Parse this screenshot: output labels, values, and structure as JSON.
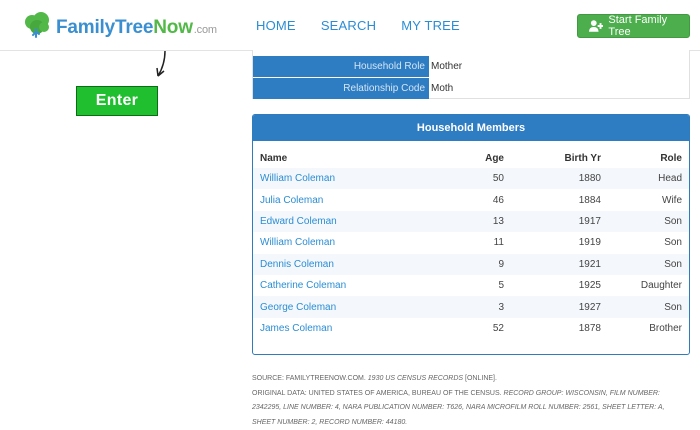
{
  "header": {
    "logo": {
      "family": "FamilyTree",
      "now": "Now",
      "com": ".com"
    },
    "nav": [
      "HOME",
      "SEARCH",
      "MY TREE"
    ],
    "start_button": "Start Family Tree"
  },
  "enter_button": "Enter",
  "top_rows": [
    {
      "label": "Household Role",
      "value": "Mother"
    },
    {
      "label": "Relationship Code",
      "value": "Moth"
    }
  ],
  "household": {
    "title": "Household Members",
    "columns": {
      "name": "Name",
      "age": "Age",
      "birth_yr": "Birth Yr",
      "role": "Role"
    },
    "members": [
      {
        "name": "William Coleman",
        "age": "50",
        "birth_yr": "1880",
        "role": "Head"
      },
      {
        "name": "Julia Coleman",
        "age": "46",
        "birth_yr": "1884",
        "role": "Wife"
      },
      {
        "name": "Edward Coleman",
        "age": "13",
        "birth_yr": "1917",
        "role": "Son"
      },
      {
        "name": "William Coleman",
        "age": "11",
        "birth_yr": "1919",
        "role": "Son"
      },
      {
        "name": "Dennis Coleman",
        "age": "9",
        "birth_yr": "1921",
        "role": "Son"
      },
      {
        "name": "Catherine Coleman",
        "age": "5",
        "birth_yr": "1925",
        "role": "Daughter"
      },
      {
        "name": "George Coleman",
        "age": "3",
        "birth_yr": "1927",
        "role": "Son"
      },
      {
        "name": "James Coleman",
        "age": "52",
        "birth_yr": "1878",
        "role": "Brother"
      }
    ]
  },
  "source": {
    "line1_prefix": "SOURCE: FAMILYTREENOW.COM. ",
    "line1_italic": "1930 US CENSUS RECORDS",
    "line1_suffix": " [ONLINE].",
    "line2_prefix": "ORIGINAL DATA: UNITED STATES OF AMERICA, BUREAU OF THE CENSUS. ",
    "line2_italic": "RECORD GROUP: WISCONSIN, FILM NUMBER: 2342295, LINE NUMBER: 4, NARA PUBLICATION NUMBER: T626, NARA MICROFILM ROLL NUMBER: 2561, SHEET LETTER: A, SHEET NUMBER: 2, RECORD NUMBER: 44180."
  }
}
